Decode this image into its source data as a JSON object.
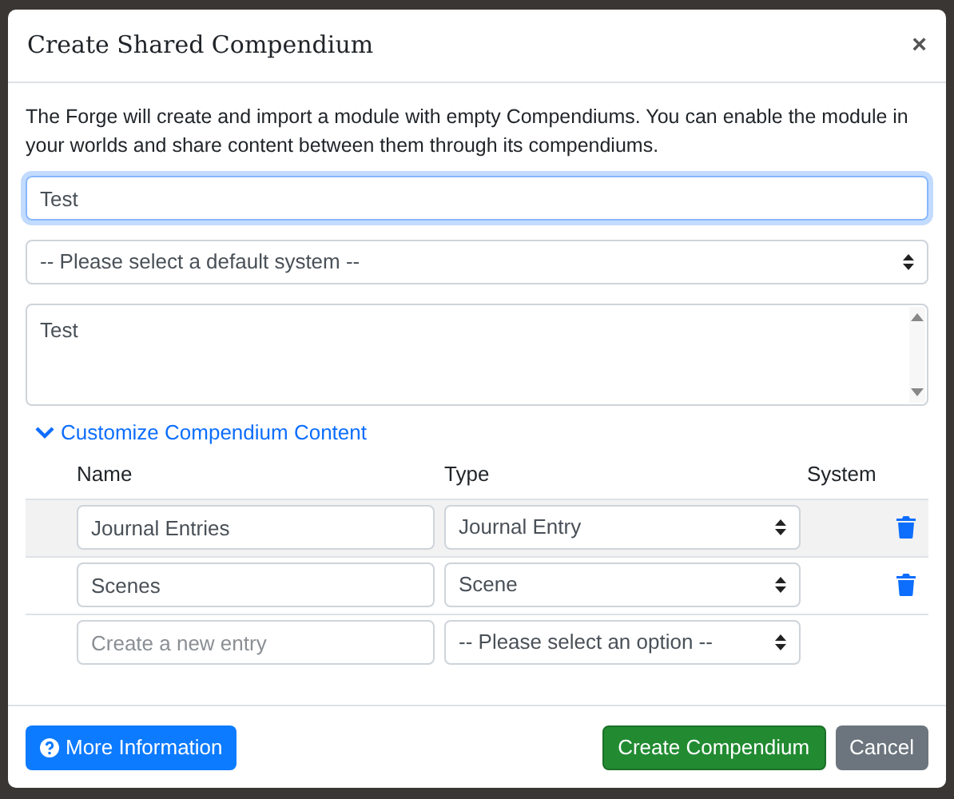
{
  "dialog": {
    "title": "Create Shared Compendium",
    "close": "×"
  },
  "description": "The Forge will create and import a module with empty Compendiums. You can enable the module in your worlds and share content between them through its compendiums.",
  "name_field": {
    "value": "Test",
    "focused": true
  },
  "system_select": {
    "value": "-- Please select a default system --"
  },
  "description_field": {
    "value": "Test"
  },
  "customize_link": {
    "label": "Customize Compendium Content",
    "expanded": true
  },
  "table": {
    "columns": [
      "Name",
      "Type",
      "System"
    ],
    "rows": [
      {
        "kind": "entry",
        "name": "Journal Entries",
        "type": "Journal Entry",
        "hovered": true
      },
      {
        "kind": "entry",
        "name": "Scenes",
        "type": "Scene",
        "hovered": false
      },
      {
        "kind": "new",
        "placeholder": "Create a new entry",
        "type": "-- Please select an option --",
        "hovered": false
      }
    ]
  },
  "footer": {
    "info_button": "More Information",
    "create_button": "Create Compendium",
    "cancel_button": "Cancel"
  }
}
